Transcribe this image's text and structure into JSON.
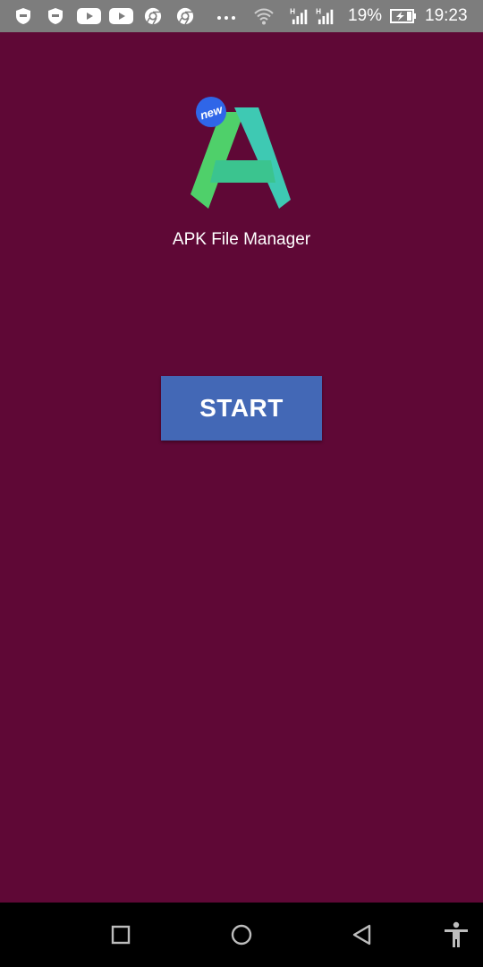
{
  "status_bar": {
    "battery_percent": "19%",
    "time": "19:23",
    "icons": [
      "shield-icon",
      "shield-icon",
      "youtube-icon",
      "youtube-icon",
      "chrome-icon",
      "chrome-icon",
      "more-notifications-icon",
      "wifi-icon",
      "signal-h-icon",
      "signal-h-icon",
      "battery-charging-icon"
    ]
  },
  "app": {
    "badge": "new",
    "name": "APK File Manager"
  },
  "main": {
    "start_label": "START"
  },
  "nav_bar": {
    "icons": [
      "recents-icon",
      "home-icon",
      "back-icon",
      "accessibility-icon"
    ]
  },
  "colors": {
    "background": "#5f0836",
    "status_bar": "#7d7d7d",
    "button": "#4368b6",
    "logo_green": "#4fd06a",
    "logo_teal": "#3ec9b3"
  }
}
